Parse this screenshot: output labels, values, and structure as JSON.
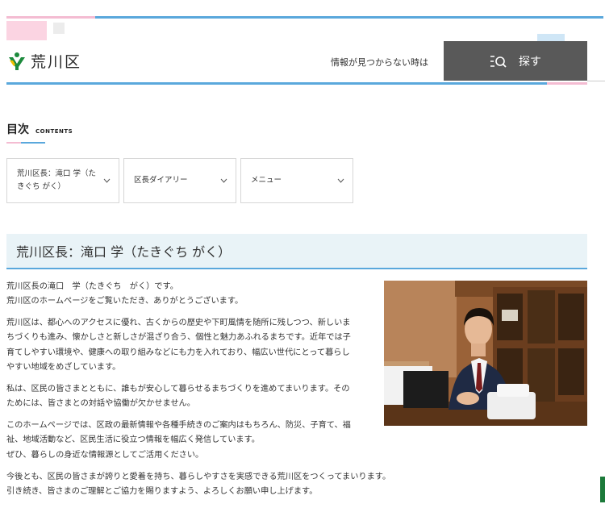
{
  "header": {
    "logo_text": "荒川区",
    "notfound_text": "情報が見つからない時は",
    "search_label": "探す"
  },
  "toc": {
    "title": "目次",
    "subtitle": "CONTENTS",
    "items": [
      {
        "line1": "荒川区長：滝口 学（た",
        "line2": "きぐち がく）"
      },
      {
        "label": "区長ダイアリー"
      },
      {
        "label": "メニュー"
      }
    ]
  },
  "section": {
    "heading": "荒川区長：滝口 学（たきぐち がく）",
    "paragraphs": [
      [
        "荒川区長の滝口　学（たきぐち　がく）です。",
        "荒川区のホームページをご覧いただき、ありがとうございます。"
      ],
      [
        "荒川区は、都心へのアクセスに優れ、古くからの歴史や下町風情を随所に残しつつ、新しいま",
        "ちづくりも進み、懐かしさと新しさが混ざり合う、個性と魅力あふれるまちです。近年では子",
        "育てしやすい環境や、健康への取り組みなどにも力を入れており、幅広い世代にとって暮らし",
        "やすい地域をめざしています。"
      ],
      [
        "私は、区民の皆さまとともに、誰もが安心して暮らせるまちづくりを進めてまいります。その",
        "ためには、皆さまとの対話や協働が欠かせません。"
      ],
      [
        "このホームページでは、区政の最新情報や各種手続きのご案内はもちろん、防災、子育て、福",
        "祉、地域活動など、区民生活に役立つ情報を幅広く発信しています。",
        "ぜひ、暮らしの身近な情報源としてご活用ください。"
      ],
      [
        "今後とも、区民の皆さまが誇りと愛着を持ち、暮らしやすさを実感できる荒川区をつくってまいります。",
        "引き続き、皆さまのご理解とご協力を賜りますよう、よろしくお願い申し上げます。"
      ]
    ]
  },
  "colors": {
    "accent_blue": "#5aa8dc",
    "accent_pink": "#f4bcd2",
    "band_bg": "#e9f3f7",
    "search_bg": "#595959",
    "logo_green": "#1c8a3c"
  },
  "icons": {
    "logo": "arakawa-logo-icon",
    "search": "search-icon",
    "chevron": "chevron-down-icon",
    "photo": "mayor-photo"
  }
}
